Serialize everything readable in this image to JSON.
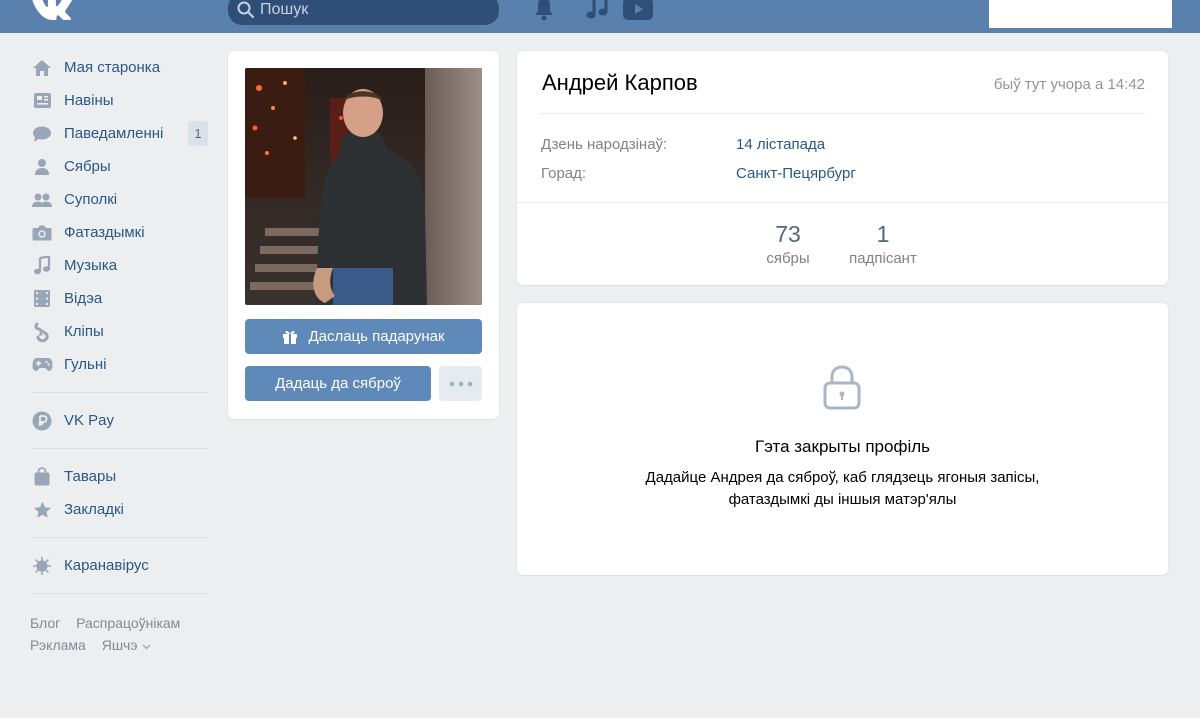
{
  "header": {
    "logo": "vk-logo",
    "search_placeholder": "Пошук",
    "icons": [
      "bell-icon",
      "music-icon",
      "video-play-icon"
    ],
    "colors": {
      "bar": "#5a80ad",
      "search": "#2f4f78"
    }
  },
  "sidebar": {
    "items": [
      {
        "icon": "home-icon",
        "label": "Мая старонка"
      },
      {
        "icon": "news-icon",
        "label": "Навіны"
      },
      {
        "icon": "messages-icon",
        "label": "Паведамленні",
        "badge": "1"
      },
      {
        "icon": "friends-icon",
        "label": "Сябры"
      },
      {
        "icon": "communities-icon",
        "label": "Суполкі"
      },
      {
        "icon": "camera-icon",
        "label": "Фатаздымкі"
      },
      {
        "icon": "music-note-icon",
        "label": "Музыка"
      },
      {
        "icon": "film-icon",
        "label": "Відэа"
      },
      {
        "icon": "clips-icon",
        "label": "Кліпы"
      },
      {
        "icon": "gamepad-icon",
        "label": "Гульні"
      }
    ],
    "pay": {
      "icon": "vkpay-icon",
      "label": "VK Pay"
    },
    "extra": [
      {
        "icon": "bag-icon",
        "label": "Тавары"
      },
      {
        "icon": "star-icon",
        "label": "Закладкі"
      }
    ],
    "covid": {
      "icon": "virus-icon",
      "label": "Каранавірус"
    },
    "footer": {
      "blog": "Блог",
      "developers": "Распрацоўнікам",
      "ads": "Рэклама",
      "more": "Яшчэ"
    }
  },
  "photo_card": {
    "gift_button": "Даслаць падарунак",
    "add_friend_button": "Дадаць да сяброў",
    "more_button": "•••"
  },
  "profile": {
    "name": "Андрей Карпов",
    "status": "быў тут учора а 14:42",
    "birthday_label": "Дзень народзінаў:",
    "birthday_value": "14 лістапада",
    "city_label": "Горад:",
    "city_value": "Санкт-Пецярбург",
    "counters": [
      {
        "value": "73",
        "label": "сябры"
      },
      {
        "value": "1",
        "label": "падпісант"
      }
    ]
  },
  "closed_profile": {
    "icon": "lock-icon",
    "title": "Гэта закрыты профіль",
    "description_line1": "Дадайце Андрея да сяброў, каб глядзець ягоныя запісы,",
    "description_line2": "фатаздымкі ды іншыя матэр'ялы"
  },
  "colors": {
    "link": "#2a5885",
    "button": "#5f89b8",
    "page_bg": "#edeef0"
  }
}
